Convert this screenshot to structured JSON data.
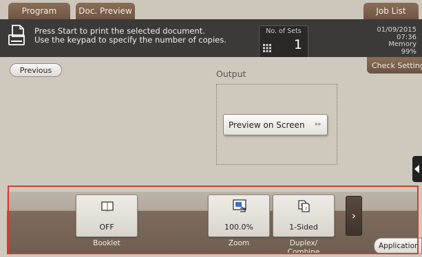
{
  "tabs": {
    "program": "Program",
    "doc_preview": "Doc. Preview",
    "job_list": "Job List"
  },
  "status": {
    "message_line1": "Press Start to print the selected document.",
    "message_line2": "Use the keypad to specify the number of copies.",
    "sets_label": "No. of Sets",
    "sets_value": "1",
    "date": "01/09/2015",
    "time": "07:36",
    "memory_label": "Memory",
    "memory_value": "99%"
  },
  "content": {
    "previous_label": "Previous",
    "check_setting_label": "Check Setting",
    "output_label": "Output",
    "preview_on_screen_label": "Preview on Screen"
  },
  "functions": {
    "booklet": {
      "value": "OFF",
      "label": "Booklet"
    },
    "zoom": {
      "value": "100.0%",
      "label": "Zoom"
    },
    "duplex": {
      "value": "1-Sided",
      "label_line1": "Duplex/",
      "label_line2": "Combine"
    },
    "next_glyph": "›",
    "application_label": "Application"
  },
  "icons": {
    "document": "document-icon",
    "keypad": "keypad-icon",
    "booklet": "booklet-icon",
    "zoom": "zoom-icon",
    "duplex": "duplex-icon",
    "side_panel": "panel-open-arrow-icon"
  },
  "colors": {
    "tab_brown": "#7a604d",
    "status_bg": "#3c3a38",
    "panel_bg": "#cfc9bd",
    "highlight_red": "#d23b35"
  }
}
